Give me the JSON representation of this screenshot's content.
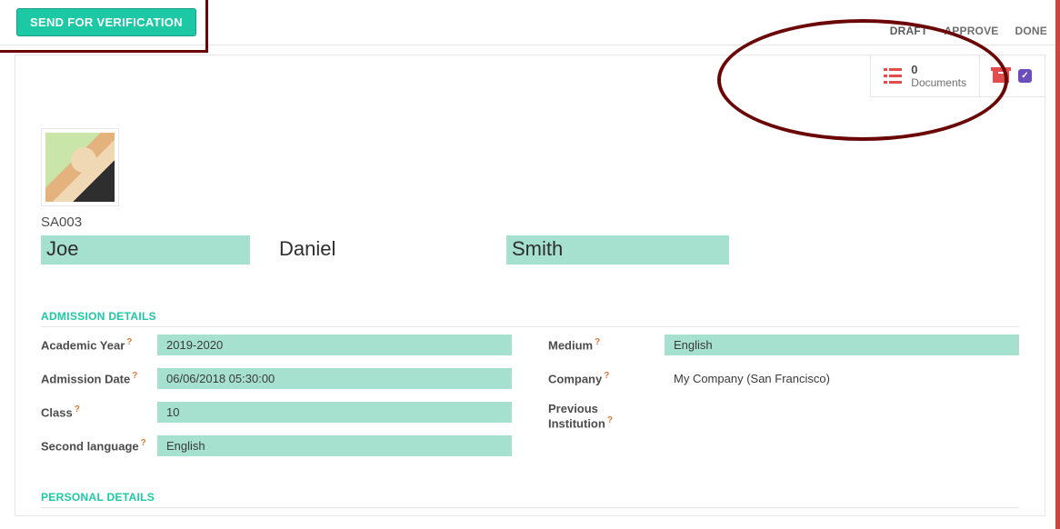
{
  "actions": {
    "send_for_verification": "SEND FOR VERIFICATION"
  },
  "status_steps": [
    "DRAFT",
    "APPROVE",
    "DONE"
  ],
  "smart_buttons": {
    "documents_count": "0",
    "documents_label": "Documents"
  },
  "profile": {
    "reg_no": "SA003",
    "first_name": "Joe",
    "middle_name": "Daniel",
    "last_name": "Smith"
  },
  "sections": {
    "admission_title": "ADMISSION DETAILS",
    "personal_title": "PERSONAL DETAILS"
  },
  "admission": {
    "labels": {
      "academic_year": "Academic Year",
      "admission_date": "Admission Date",
      "class": "Class",
      "second_language": "Second language",
      "medium": "Medium",
      "company": "Company",
      "previous_institution": "Previous Institution"
    },
    "values": {
      "academic_year": "2019-2020",
      "admission_date": "06/06/2018 05:30:00",
      "class": "10",
      "second_language": "English",
      "medium": "English",
      "company": "My Company (San Francisco)",
      "previous_institution": ""
    }
  },
  "qmark": "?"
}
